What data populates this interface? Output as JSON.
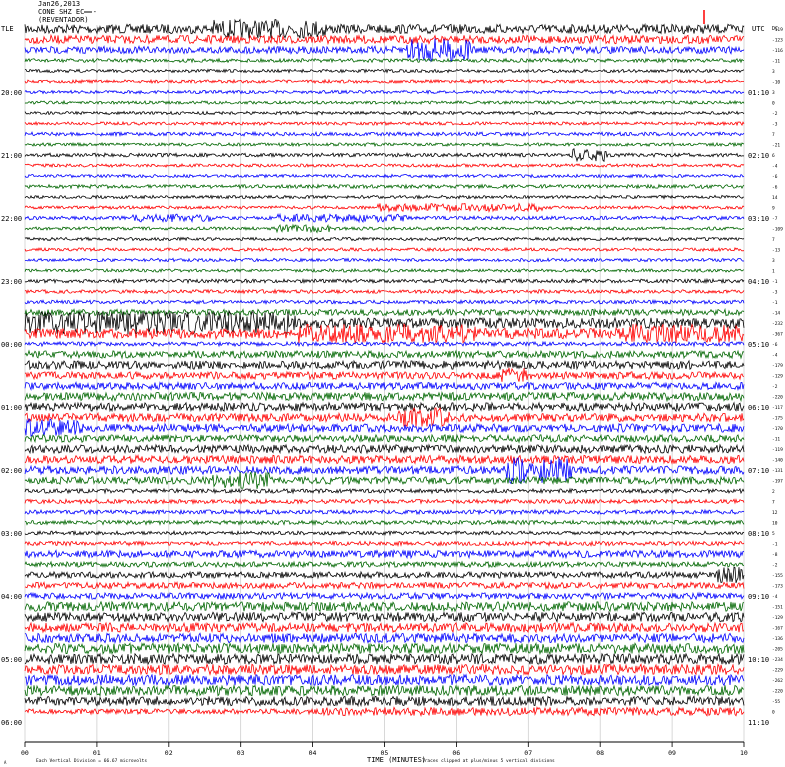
{
  "header": {
    "date": "Jan26,2013",
    "station": "CONE SHZ EC --",
    "location": "(REVENTADOR)"
  },
  "timezones": {
    "left": "TLE",
    "right": "UTC"
  },
  "footer": {
    "scale_note": "Each Vertical Division = 66.67 microvolts",
    "clip_note": "Traces clipped at plus/minus 5 vertical divisions",
    "small_mark": "A"
  },
  "colors": {
    "cycle": [
      "#000000",
      "#ff0000",
      "#0000ff",
      "#006600"
    ],
    "grid": "#c8c8c8",
    "mark": "#ff0000"
  },
  "chart_data": {
    "type": "line",
    "title": "Jan26,2013",
    "xlabel": "TIME (MINUTES)",
    "ylabel": "",
    "x_ticks": [
      "00",
      "01",
      "02",
      "03",
      "04",
      "05",
      "06",
      "07",
      "08",
      "09",
      "10"
    ],
    "xlim": [
      0,
      10
    ],
    "rows_per_hour": 6,
    "left_hour_labels": [
      "20:00",
      "21:00",
      "22:00",
      "23:00",
      "00:00",
      "01:00",
      "02:00",
      "03:00",
      "04:00",
      "05:00",
      "06:00"
    ],
    "right_hour_labels": [
      "01:10",
      "02:10",
      "03:10",
      "04:10",
      "05:10",
      "06:10",
      "07:10",
      "08:10",
      "09:10",
      "10:10",
      "11:10"
    ],
    "right_top_label": "DC",
    "row_offsets": [
      "-119",
      "-123",
      "-116",
      "-11",
      "3",
      "-10",
      "3",
      "0",
      "-2",
      "-3",
      "7",
      "-21",
      "6",
      "-4",
      "-6",
      "-6",
      "14",
      "9",
      "-7",
      "-109",
      "7",
      "-13",
      "3",
      "1",
      "-1",
      "-3",
      "-1",
      "-14",
      "-232",
      "-367",
      "-6",
      "-4",
      "-179",
      "-129",
      "-2",
      "-220",
      "-117",
      "-175",
      "-170",
      "-11",
      "-119",
      "-140",
      "-131",
      "-197",
      "2",
      "7",
      "12",
      "10",
      "5",
      "-1",
      "-8",
      "-2",
      "-155",
      "-173",
      "-4",
      "-151",
      "-129",
      "-167",
      "-136",
      "-205",
      "-234",
      "-229",
      "-262",
      "-220",
      "-55",
      "0"
    ],
    "series": [
      {
        "name": "",
        "rows": 66,
        "amplitude_profile": [
          0.9,
          0.8,
          0.7,
          0.35,
          0.3,
          0.3,
          0.3,
          0.3,
          0.3,
          0.3,
          0.35,
          0.3,
          0.35,
          0.3,
          0.3,
          0.35,
          0.3,
          0.3,
          0.35,
          0.3,
          0.3,
          0.3,
          0.3,
          0.3,
          0.35,
          0.35,
          0.35,
          0.6,
          1.0,
          1.0,
          0.4,
          0.7,
          0.8,
          0.7,
          0.7,
          0.8,
          0.8,
          0.8,
          0.8,
          0.7,
          0.8,
          0.8,
          0.8,
          0.7,
          0.4,
          0.4,
          0.4,
          0.4,
          0.35,
          0.4,
          0.7,
          0.5,
          0.6,
          0.6,
          0.6,
          0.9,
          0.9,
          0.9,
          0.9,
          1.0,
          1.0,
          1.0,
          1.0,
          1.0,
          0.9,
          0.5
        ]
      }
    ],
    "bursts": [
      {
        "row": 0,
        "start_min": 2.6,
        "end_min": 4.2,
        "gain": 2.0
      },
      {
        "row": 2,
        "start_min": 5.3,
        "end_min": 6.2,
        "gain": 3.2
      },
      {
        "row": 12,
        "start_min": 7.6,
        "end_min": 8.1,
        "gain": 3.5
      },
      {
        "row": 17,
        "start_min": 4.9,
        "end_min": 7.2,
        "gain": 2.6
      },
      {
        "row": 18,
        "start_min": 1.5,
        "end_min": 2.6,
        "gain": 2.2
      },
      {
        "row": 18,
        "start_min": 3.5,
        "end_min": 5.3,
        "gain": 2.2
      },
      {
        "row": 19,
        "start_min": 3.5,
        "end_min": 4.3,
        "gain": 2.5
      },
      {
        "row": 28,
        "start_min": 0.0,
        "end_min": 3.8,
        "gain": 2.2
      },
      {
        "row": 29,
        "start_min": 3.8,
        "end_min": 6.3,
        "gain": 1.8
      },
      {
        "row": 29,
        "start_min": 8.3,
        "end_min": 10.0,
        "gain": 1.8
      },
      {
        "row": 33,
        "start_min": 6.6,
        "end_min": 7.0,
        "gain": 2.2
      },
      {
        "row": 37,
        "start_min": 5.2,
        "end_min": 5.9,
        "gain": 2.4
      },
      {
        "row": 38,
        "start_min": 0.0,
        "end_min": 0.8,
        "gain": 2.2
      },
      {
        "row": 42,
        "start_min": 6.7,
        "end_min": 7.6,
        "gain": 3.2
      },
      {
        "row": 43,
        "start_min": 2.6,
        "end_min": 3.4,
        "gain": 2.4
      },
      {
        "row": 52,
        "start_min": 9.6,
        "end_min": 10.0,
        "gain": 2.6
      },
      {
        "row": 65,
        "start_min": 4.1,
        "end_min": 10.0,
        "gain": 1.6
      }
    ]
  }
}
